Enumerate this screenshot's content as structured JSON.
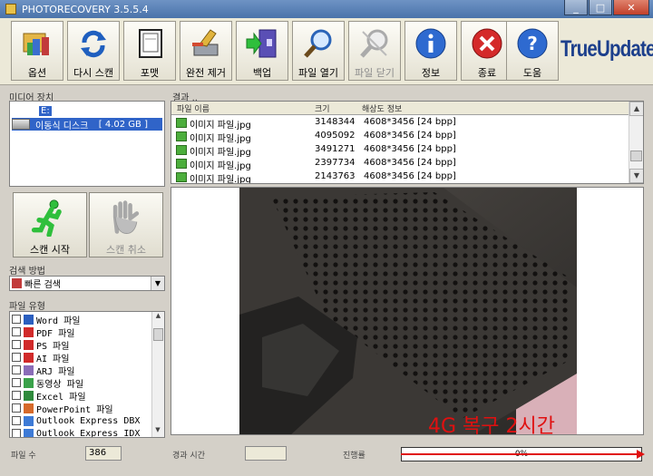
{
  "window": {
    "title": "PHOTORECOVERY 3.5.5.4"
  },
  "toolbar": {
    "buttons": [
      {
        "label": "옵션",
        "icon": "options-icon"
      },
      {
        "label": "다시 스캔",
        "icon": "rescan-icon"
      },
      {
        "label": "포맷",
        "icon": "format-icon"
      },
      {
        "label": "완전 제거",
        "icon": "wipe-icon"
      },
      {
        "label": "백업",
        "icon": "backup-icon"
      },
      {
        "label": "파일 열기",
        "icon": "magnifier-icon"
      },
      {
        "label": "파일 닫기",
        "icon": "close-file-icon"
      },
      {
        "label": "정보",
        "icon": "info-icon"
      },
      {
        "label": "종료",
        "icon": "exit-icon"
      },
      {
        "label": "도움",
        "icon": "help-icon"
      }
    ],
    "logo": "TrueUpdate"
  },
  "drives": {
    "label": "미디어 장치",
    "items": [
      {
        "name": "E:",
        "size": ""
      },
      {
        "name": "이동식 디스크",
        "size": "[ 4.02 GB ]"
      }
    ]
  },
  "files": {
    "label": "결과 ..",
    "columns": [
      "파일 이름",
      "크기",
      "해상도 정보"
    ],
    "rows": [
      {
        "name": "이미지 파일.jpg",
        "size": "3148344",
        "info": "4608*3456 [24 bpp]"
      },
      {
        "name": "이미지 파일.jpg",
        "size": "4095092",
        "info": "4608*3456 [24 bpp]"
      },
      {
        "name": "이미지 파일.jpg",
        "size": "3491271",
        "info": "4608*3456 [24 bpp]"
      },
      {
        "name": "이미지 파일.jpg",
        "size": "2397734",
        "info": "4608*3456 [24 bpp]"
      },
      {
        "name": "이미지 파일.jpg",
        "size": "2143763",
        "info": "4608*3456 [24 bpp]"
      }
    ]
  },
  "scan": {
    "start_label": "스캔 시작",
    "cancel_label": "스캔 취소"
  },
  "search": {
    "label": "검색 방법",
    "selected": "빠른 검색"
  },
  "types": {
    "label": "파일 유형",
    "items": [
      "Word 파일",
      "PDF 파일",
      "PS 파일",
      "AI 파일",
      "ARJ 파일",
      "동영상 파일",
      "Excel 파일",
      "PowerPoint 파일",
      "Outlook Express DBX",
      "Outlook Express IDX"
    ]
  },
  "status": {
    "count_label": "파일 수",
    "count_value": "386",
    "elapsed_label": "경과 시간",
    "elapsed_value": "",
    "progress_label": "진행률",
    "progress_value": "0%",
    "progress_fraction": 0
  },
  "overlay": {
    "text": "4G 복구 2시간"
  },
  "colors": {
    "accent": "#3064c8",
    "overlay_red": "#e01010"
  }
}
